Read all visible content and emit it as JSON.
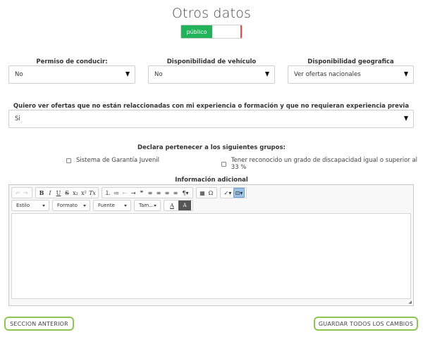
{
  "page": {
    "title": "Otros datos",
    "visibility_toggle": {
      "label": "público",
      "state": "on"
    }
  },
  "fields": {
    "license": {
      "label": "Permiso de conducir:",
      "value": "No"
    },
    "vehicle": {
      "label": "Disponibilidad de vehículo",
      "value": "No"
    },
    "geo": {
      "label": "Disponibilidad geografica",
      "value": "Ver ofertas nacionales"
    },
    "unrelated_offers": {
      "label": "Quiero ver ofertas que no están relaccionadas con mi experiencia o formación y que no requieran experiencia previa",
      "value": "Si"
    }
  },
  "groups": {
    "label": "Declara pertenecer a los siguientes grupos:",
    "options": [
      {
        "label": "Sistema de Garantía Juvenil",
        "checked": false
      },
      {
        "label": "Tener reconocido un grado de discapacidad igual o superior al 33 %",
        "checked": false
      }
    ]
  },
  "editor": {
    "label": "Información adicional",
    "toolbar_row1": {
      "undo": "↶",
      "redo": "↷",
      "bold": "B",
      "italic": "I",
      "underline": "U",
      "strike": "S",
      "subscript": "x₂",
      "superscript": "x²",
      "clear_format": "Tx",
      "numbered_list": "⒈",
      "bullet_list": "≔",
      "outdent": "⇤",
      "indent": "⇥",
      "blockquote": "❞",
      "align_left": "≡",
      "align_center": "≡",
      "align_right": "≡",
      "align_justify": "≡",
      "text_direction": "¶▾",
      "table": "▦",
      "special_char": "Ω",
      "spellcheck": "✓▾",
      "source": "⊡▾"
    },
    "toolbar_row2": {
      "style": "Estilo",
      "format": "Formato",
      "font": "Fuente",
      "size": "Tam...",
      "text_color": "A",
      "bg_color": "A"
    },
    "content": "",
    "resize_handle": "◢"
  },
  "actions": {
    "previous": "SECCION ANTERIOR",
    "save_all": "GUARDAR TODOS LOS CAMBIOS"
  },
  "colors": {
    "toggle_on": "#22b35a",
    "toggle_off_accent": "#d9534f",
    "button_border": "#8fc552",
    "toolbar_highlight": "#9ec3e6"
  }
}
